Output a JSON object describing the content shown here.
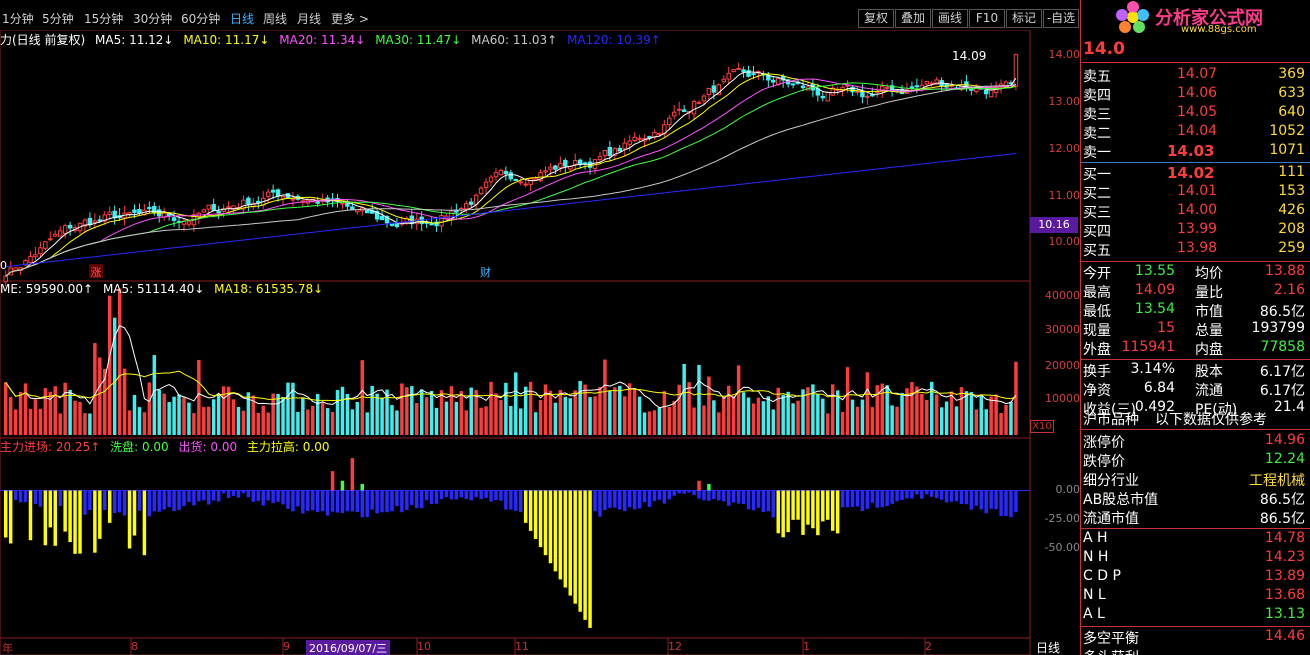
{
  "toolbar": {
    "periods": [
      "1分钟",
      "5分钟",
      "15分钟",
      "30分钟",
      "60分钟",
      "日线",
      "周线",
      "月线",
      "更多 >"
    ],
    "active_period": "日线",
    "buttons": [
      "复权",
      "叠加",
      "画线",
      "F10",
      "标记",
      "-自选"
    ]
  },
  "legend_main": {
    "title": "力(日线 前复权)",
    "ma5": "MA5: 11.12↓",
    "ma10": "MA10: 11.17↓",
    "ma20": "MA20: 11.34↓",
    "ma30": "MA30: 11.47↓",
    "ma60": "MA60: 11.03↑",
    "ma120": "MA120: 10.39↑",
    "high_marker": "14.09",
    "low_marker": "0",
    "events": [
      "涨",
      "财"
    ]
  },
  "legend_volume": {
    "vol": "ME: 59590.00↑",
    "ma5": "MA5: 51114.40↓",
    "ma18": "MA18: 61535.78↓"
  },
  "legend_indicator": {
    "a": "主力进场: 20.25↑",
    "b": "洗盘: 0.00",
    "c": "出货: 0.00",
    "d": "主力拉高: 0.00"
  },
  "price_axis": [
    "14.00",
    "13.00",
    "12.00",
    "11.00",
    "10.00"
  ],
  "price_highlight": "10.16",
  "volume_axis": [
    "40000",
    "30000",
    "20000",
    "10000"
  ],
  "volume_unit": "X10",
  "indicator_axis": [
    "0.00",
    "-25.00",
    "-50.00"
  ],
  "date_axis": [
    "年",
    "8",
    "9",
    "2016/09/07/三",
    "10",
    "11",
    "12",
    "1",
    "2"
  ],
  "bottom_right": "日线",
  "colors": {
    "up": "#ff3c3c",
    "down": "#3cf0f0",
    "ma5": "#ffffff",
    "ma10": "#ffff00",
    "ma20": "#ff50ff",
    "ma30": "#40ff40",
    "ma60": "#c8c8c8",
    "ma120": "#2828ff",
    "grid": "#8c1e1e"
  },
  "quote": {
    "price": "14.0",
    "logo_title": "分析家公式网",
    "logo_url": "www.88gs.com",
    "asks": [
      {
        "label": "卖五",
        "price": "14.07",
        "vol": "369"
      },
      {
        "label": "卖四",
        "price": "14.06",
        "vol": "633"
      },
      {
        "label": "卖三",
        "price": "14.05",
        "vol": "640"
      },
      {
        "label": "卖二",
        "price": "14.04",
        "vol": "1052"
      },
      {
        "label": "卖一",
        "price": "14.03",
        "vol": "1071"
      }
    ],
    "bids": [
      {
        "label": "买一",
        "price": "14.02",
        "vol": "111"
      },
      {
        "label": "买二",
        "price": "14.01",
        "vol": "153"
      },
      {
        "label": "买三",
        "price": "14.00",
        "vol": "426"
      },
      {
        "label": "买四",
        "price": "13.99",
        "vol": "208"
      },
      {
        "label": "买五",
        "price": "13.98",
        "vol": "259"
      }
    ],
    "stats": [
      {
        "l1": "今开",
        "v1": "13.55",
        "c1": "g",
        "l2": "均价",
        "v2": "13.88",
        "c2": "r"
      },
      {
        "l1": "最高",
        "v1": "14.09",
        "c1": "r",
        "l2": "量比",
        "v2": "2.16",
        "c2": "r"
      },
      {
        "l1": "最低",
        "v1": "13.54",
        "c1": "g",
        "l2": "市值",
        "v2": "86.5亿",
        "c2": "w"
      },
      {
        "l1": "现量",
        "v1": "15",
        "c1": "r",
        "l2": "总量",
        "v2": "193799",
        "c2": "w"
      },
      {
        "l1": "外盘",
        "v1": "115941",
        "c1": "r",
        "l2": "内盘",
        "v2": "77858",
        "c2": "g"
      }
    ],
    "stats2": [
      {
        "l1": "换手",
        "v1": "3.14%",
        "l2": "股本",
        "v2": "6.17亿"
      },
      {
        "l1": "净资",
        "v1": "6.84",
        "l2": "流通",
        "v2": "6.17亿"
      },
      {
        "l1": "收益(三)",
        "v1": "0.492",
        "l2": "PE(动)",
        "v2": "21.4"
      }
    ],
    "market_title": "沪市品种",
    "market_note": "以下数据仅供参考",
    "limits": [
      {
        "label": "涨停价",
        "value": "14.96",
        "c": "r"
      },
      {
        "label": "跌停价",
        "value": "12.24",
        "c": "g"
      },
      {
        "label": "细分行业",
        "value": "工程机械",
        "c": "y"
      },
      {
        "label": "AB股总市值",
        "value": "86.5亿",
        "c": "w"
      },
      {
        "label": "流通市值",
        "value": "86.5亿",
        "c": "w"
      }
    ],
    "extras": [
      {
        "label": "A H",
        "value": "14.78",
        "c": "r"
      },
      {
        "label": "N H",
        "value": "14.23",
        "c": "r"
      },
      {
        "label": "C D P",
        "value": "13.89",
        "c": "r"
      },
      {
        "label": "N L",
        "value": "13.68",
        "c": "r"
      },
      {
        "label": "A L",
        "value": "13.13",
        "c": "g"
      }
    ],
    "balance": [
      {
        "label": "多空平衡",
        "value": "14.46",
        "c": "r"
      },
      {
        "label": "多头获利",
        "value": "",
        "c": "r"
      }
    ]
  },
  "chart_data": {
    "type": "candlestick",
    "start_price": 9.8,
    "end_price": 14.0,
    "ylim_price": [
      9.7,
      14.4
    ],
    "ylim_volume": [
      0,
      42000
    ],
    "ylim_indicator": [
      -90,
      30
    ]
  }
}
